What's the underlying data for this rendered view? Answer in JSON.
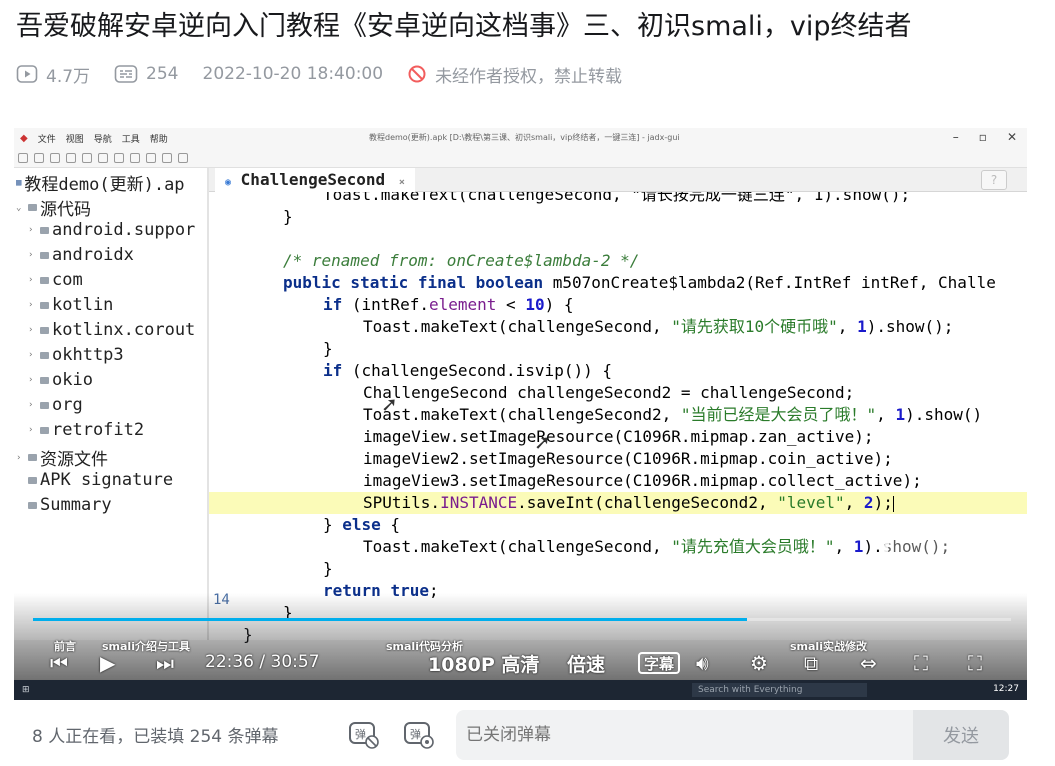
{
  "video": {
    "title": "吾爱破解安卓逆向入门教程《安卓逆向这档事》三、初识smali，vip终结者",
    "views": "4.7万",
    "danmaku_count": "254",
    "publish_time": "2022-10-20 18:40:00",
    "copyright_notice": "未经作者授权，禁止转载"
  },
  "ide": {
    "menu": [
      "文件",
      "视图",
      "导航",
      "工具",
      "帮助"
    ],
    "window_title": "教程demo(更新).apk [D:\\教程\\第三课、初识smali，vip终结者，一键三连] - jadx-gui",
    "tree": {
      "root": "教程demo(更新).ap",
      "items": [
        {
          "label": "源代码",
          "indent": 1
        },
        {
          "label": "android.suppor",
          "indent": 2
        },
        {
          "label": "androidx",
          "indent": 2
        },
        {
          "label": "com",
          "indent": 2
        },
        {
          "label": "kotlin",
          "indent": 2
        },
        {
          "label": "kotlinx.corout",
          "indent": 2
        },
        {
          "label": "okhttp3",
          "indent": 2
        },
        {
          "label": "okio",
          "indent": 2
        },
        {
          "label": "org",
          "indent": 2
        },
        {
          "label": "retrofit2",
          "indent": 2
        },
        {
          "label": "资源文件",
          "indent": 1
        },
        {
          "label": "APK signature",
          "indent": 1
        },
        {
          "label": "Summary",
          "indent": 1
        }
      ]
    },
    "tab_label": "ChallengeSecond",
    "help_icon": "?",
    "code": {
      "l0": "Toast.makeText(challengeSecond, \"请长按完成一键三连\", 1).show();",
      "l1": "}",
      "l2": "/* renamed from: onCreate$lambda-2 */",
      "l3_kw": "public static final boolean",
      "l3_rest": " m507onCreate$lambda2(Ref.IntRef intRef, Challe",
      "l4_a": "if",
      "l4_b": " (intRef.",
      "l4_c": "element",
      "l4_d": " < ",
      "l4_e": "10",
      "l4_f": ") {",
      "l5_a": "Toast.makeText(challengeSecond, ",
      "l5_s": "\"请先获取10个硬币哦\"",
      "l5_b": ", ",
      "l5_n": "1",
      "l5_c": ").show();",
      "l6": "}",
      "l7_a": "if",
      "l7_b": " (challengeSecond.isvip()) {",
      "l8": "ChallengeSecond challengeSecond2 = challengeSecond;",
      "l9_a": "Toast.makeText(challengeSecond2, ",
      "l9_s": "\"当前已经是大会员了哦！\"",
      "l9_b": ", ",
      "l9_n": "1",
      "l9_c": ").show()",
      "l10": "imageView.setImageResource(C1096R.mipmap.zan_active);",
      "l11": "imageView2.setImageResource(C1096R.mipmap.coin_active);",
      "l12": "imageView3.setImageResource(C1096R.mipmap.collect_active);",
      "l13_a": "SPUtils.",
      "l13_b": "INSTANCE",
      "l13_c": ".saveInt(challengeSecond2, ",
      "l13_s": "\"level\"",
      "l13_d": ", ",
      "l13_n": "2",
      "l13_e": ");",
      "l14_a": "} ",
      "l14_b": "else",
      "l14_c": " {",
      "l15_a": "Toast.makeText(challengeSecond, ",
      "l15_s": "\"请先充值大会员哦！\"",
      "l15_b": ", ",
      "l15_n": "1",
      "l15_c": ").show();",
      "l16": "}",
      "l17_a": "return",
      "l17_b": " ",
      "l17_c": "true",
      "l17_d": ";",
      "l18": "}",
      "l19": "}"
    },
    "line_number": "14"
  },
  "player": {
    "current_time": "22:36",
    "separator": "/",
    "total_time": "30:57",
    "progress": 0.73,
    "quality": "1080P 高清",
    "speed": "倍速",
    "subtitle": "字幕",
    "chapters": [
      "前言",
      "smali介绍与工具",
      "smali代码分析",
      "smali实战修改"
    ],
    "taskbar_search": "Search with Everything",
    "taskbar_clock": "12:27",
    "accent_color": "#00aeec"
  },
  "danmaku": {
    "status": "8 人正在看，已装填 254 条弹幕",
    "placeholder": "已关闭弹幕",
    "send_label": "发送"
  }
}
